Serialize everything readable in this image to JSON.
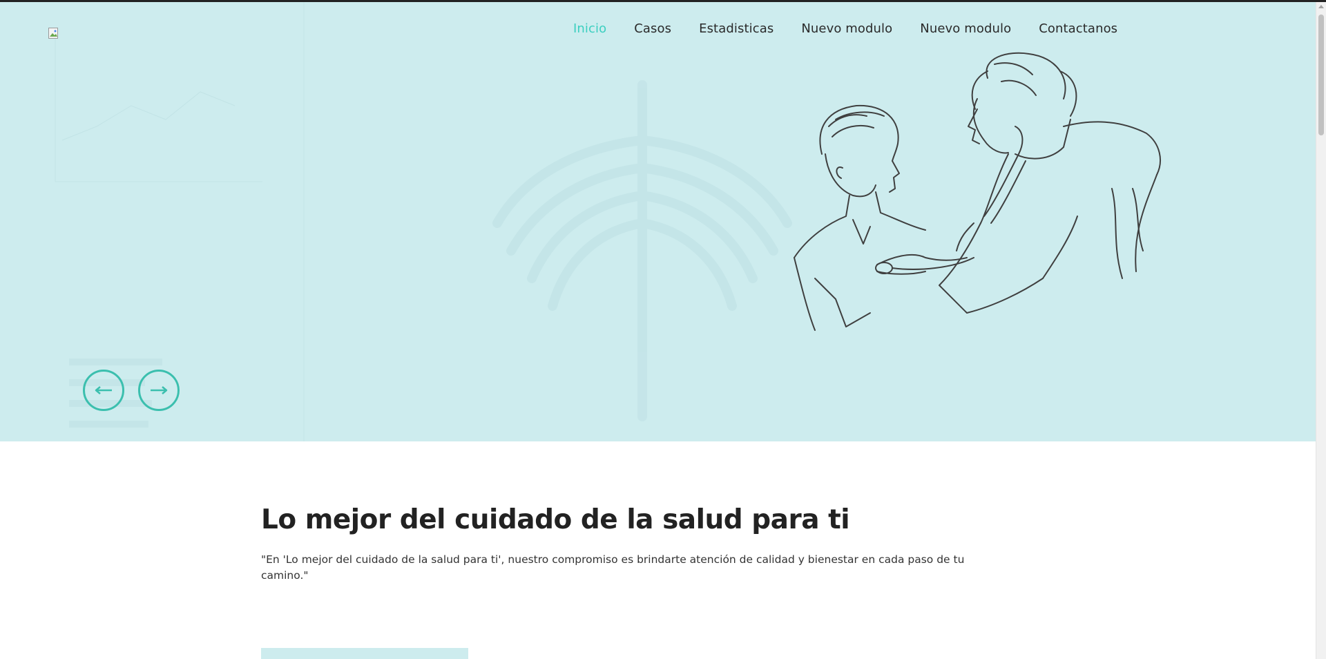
{
  "header": {
    "logo_alt": "",
    "nav": [
      {
        "label": "Inicio",
        "active": true
      },
      {
        "label": "Casos",
        "active": false
      },
      {
        "label": "Estadisticas",
        "active": false
      },
      {
        "label": "Nuevo modulo",
        "active": false
      },
      {
        "label": "Nuevo modulo",
        "active": false
      },
      {
        "label": "Contactanos",
        "active": false
      }
    ]
  },
  "hero": {
    "illustration_icon": "doctor-examining-patient-icon",
    "prev_icon": "arrow-left-icon",
    "next_icon": "arrow-right-icon",
    "accent_color": "#3bbfae",
    "background_color": "#cdecee"
  },
  "main": {
    "title": "Lo mejor del cuidado de la salud para ti",
    "description": "\"En 'Lo mejor del cuidado de la salud para ti', nuestro compromiso es brindarte atención de calidad y bienestar en cada paso de tu camino.\""
  }
}
